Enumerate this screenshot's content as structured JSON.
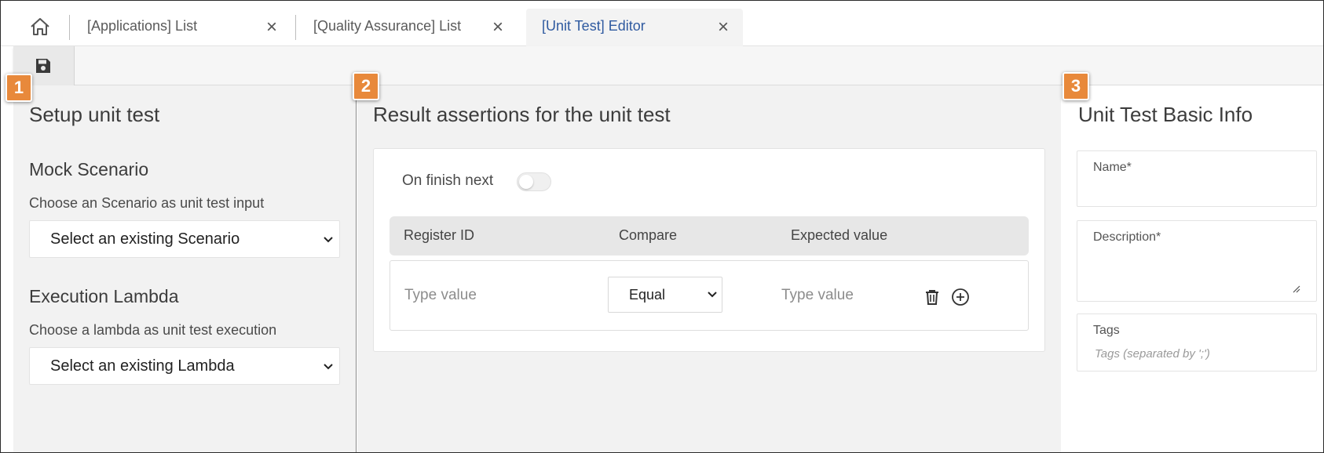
{
  "tabs": [
    {
      "label": "[Applications] List",
      "close": "×"
    },
    {
      "label": "[Quality Assurance] List",
      "close": "×"
    },
    {
      "label": "[Unit Test] Editor",
      "close": "×"
    }
  ],
  "badges": {
    "one": "1",
    "two": "2",
    "three": "3"
  },
  "setup": {
    "title": "Setup unit test",
    "mock": {
      "heading": "Mock Scenario",
      "help": "Choose an Scenario as unit test input",
      "selected": "Select an existing Scenario"
    },
    "lambda": {
      "heading": "Execution Lambda",
      "help": "Choose a lambda as unit test execution",
      "selected": "Select an existing Lambda"
    }
  },
  "assertions": {
    "title": "Result assertions for the unit test",
    "toggle_label": "On finish next",
    "toggle_on": false,
    "columns": [
      "Register ID",
      "Compare",
      "Expected value"
    ],
    "row": {
      "register_placeholder": "Type value",
      "compare_selected": "Equal",
      "expected_placeholder": "Type value"
    }
  },
  "basic_info": {
    "title": "Unit Test Basic Info",
    "name_label": "Name*",
    "description_label": "Description*",
    "tags_label": "Tags",
    "tags_placeholder": "Tags (separated by ';')"
  },
  "colors": {
    "accent_badge": "#e8893b",
    "active_tab_text": "#2f5aa0",
    "panel_bg": "#f2f2f2"
  },
  "icons": [
    "home-icon",
    "close-icon",
    "save-icon",
    "chevron-down-icon",
    "trash-icon",
    "add-circle-icon",
    "resize-handle-icon"
  ]
}
